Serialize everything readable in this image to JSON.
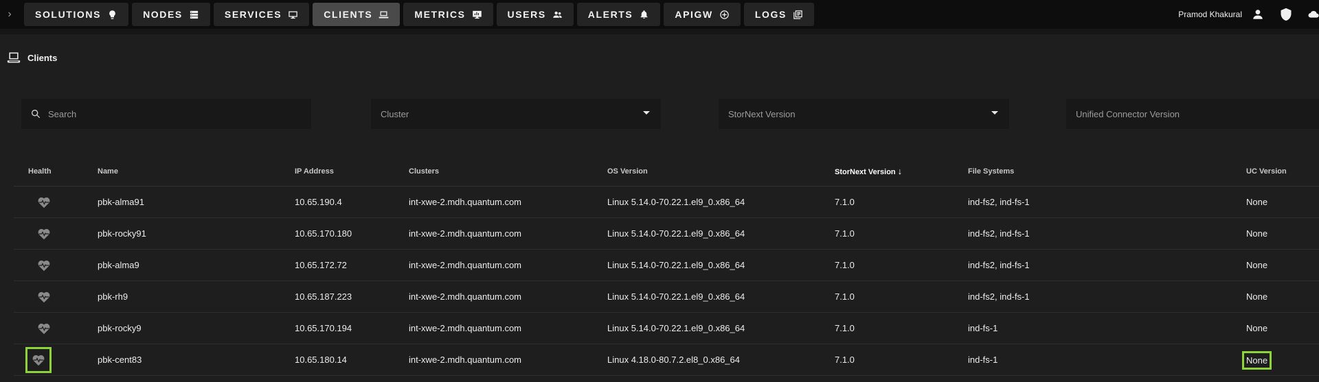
{
  "nav": {
    "tabs": [
      {
        "label": "SOLUTIONS",
        "icon": "lightbulb-icon"
      },
      {
        "label": "NODES",
        "icon": "server-icon"
      },
      {
        "label": "SERVICES",
        "icon": "monitor-icon"
      },
      {
        "label": "CLIENTS",
        "icon": "laptop-icon",
        "active": true
      },
      {
        "label": "METRICS",
        "icon": "chart-icon"
      },
      {
        "label": "USERS",
        "icon": "users-icon"
      },
      {
        "label": "ALERTS",
        "icon": "bell-icon"
      },
      {
        "label": "APIGW",
        "icon": "gateway-icon"
      },
      {
        "label": "LOGS",
        "icon": "logs-icon"
      }
    ],
    "user_name": "Pramod Khakural"
  },
  "page": {
    "title": "Clients"
  },
  "filters": {
    "search_placeholder": "Search",
    "cluster_placeholder": "Cluster",
    "stornext_placeholder": "StorNext Version",
    "uc_placeholder": "Unified Connector Version"
  },
  "table": {
    "headers": {
      "health": "Health",
      "name": "Name",
      "ip": "IP Address",
      "clusters": "Clusters",
      "os": "OS Version",
      "stornext": "StorNext Version",
      "filesystems": "File Systems",
      "uc": "UC Version"
    },
    "sort_arrow": "↓",
    "rows": [
      {
        "name": "pbk-alma91",
        "ip": "10.65.190.4",
        "clusters": "int-xwe-2.mdh.quantum.com",
        "os": "Linux 5.14.0-70.22.1.el9_0.x86_64",
        "stornext": "7.1.0",
        "filesystems": "ind-fs2, ind-fs-1",
        "uc": "None"
      },
      {
        "name": "pbk-rocky91",
        "ip": "10.65.170.180",
        "clusters": "int-xwe-2.mdh.quantum.com",
        "os": "Linux 5.14.0-70.22.1.el9_0.x86_64",
        "stornext": "7.1.0",
        "filesystems": "ind-fs2, ind-fs-1",
        "uc": "None"
      },
      {
        "name": "pbk-alma9",
        "ip": "10.65.172.72",
        "clusters": "int-xwe-2.mdh.quantum.com",
        "os": "Linux 5.14.0-70.22.1.el9_0.x86_64",
        "stornext": "7.1.0",
        "filesystems": "ind-fs2, ind-fs-1",
        "uc": "None"
      },
      {
        "name": "pbk-rh9",
        "ip": "10.65.187.223",
        "clusters": "int-xwe-2.mdh.quantum.com",
        "os": "Linux 5.14.0-70.22.1.el9_0.x86_64",
        "stornext": "7.1.0",
        "filesystems": "ind-fs2, ind-fs-1",
        "uc": "None"
      },
      {
        "name": "pbk-rocky9",
        "ip": "10.65.170.194",
        "clusters": "int-xwe-2.mdh.quantum.com",
        "os": "Linux 5.14.0-70.22.1.el9_0.x86_64",
        "stornext": "7.1.0",
        "filesystems": "ind-fs-1",
        "uc": "None"
      },
      {
        "name": "pbk-cent83",
        "ip": "10.65.180.14",
        "clusters": "int-xwe-2.mdh.quantum.com",
        "os": "Linux 4.18.0-80.7.2.el8_0.x86_64",
        "stornext": "7.1.0",
        "filesystems": "ind-fs-1",
        "uc": "None",
        "highlighted": true
      }
    ]
  },
  "colors": {
    "highlight": "#8fd33a",
    "health_icon": "#8a8a8a"
  }
}
